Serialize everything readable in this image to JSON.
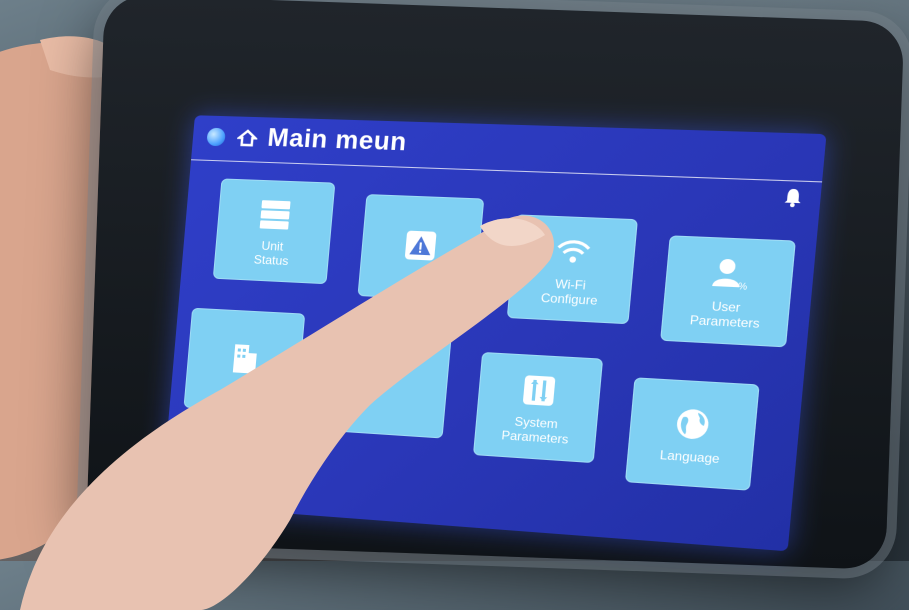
{
  "header": {
    "title": "Main meun"
  },
  "tiles": [
    {
      "label_1": "Unit",
      "label_2": "Status",
      "icon": "server-rack-icon"
    },
    {
      "label_1": "",
      "label_2": "",
      "icon": "alarm-warning-icon"
    },
    {
      "label_1": "Wi-Fi",
      "label_2": "Configure",
      "icon": "wifi-icon"
    },
    {
      "label_1": "User",
      "label_2": "Parameters",
      "icon": "user-settings-icon"
    },
    {
      "label_1": "",
      "label_2": "",
      "icon": "building-icon"
    },
    {
      "label_1": "",
      "label_2": "",
      "icon": "unknown-icon"
    },
    {
      "label_1": "System",
      "label_2": "Parameters",
      "icon": "sliders-icon"
    },
    {
      "label_1": "Language",
      "label_2": "",
      "icon": "globe-icon"
    }
  ],
  "colors": {
    "screen_bg": "#2a37b8",
    "tile_bg": "#7fd0f3",
    "text": "#ffffff"
  }
}
